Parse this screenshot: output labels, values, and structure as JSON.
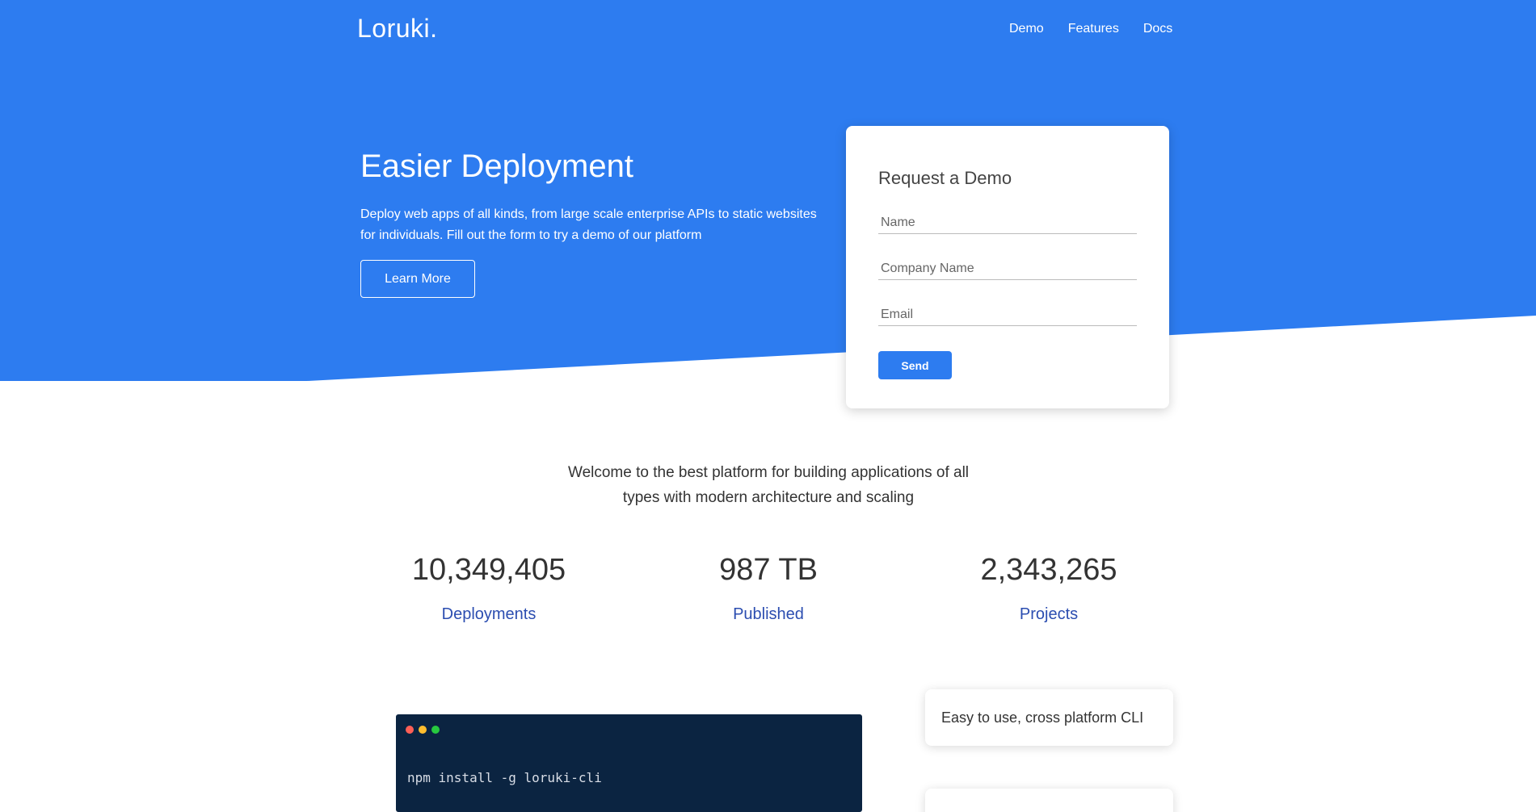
{
  "colors": {
    "brand_blue": "#2d7cf0",
    "terminal_bg": "#0b2441",
    "stat_label": "#2b4db0"
  },
  "nav": {
    "logo": "Loruki.",
    "links": [
      "Demo",
      "Features",
      "Docs"
    ]
  },
  "hero": {
    "title": "Easier Deployment",
    "text": "Deploy web apps of all kinds, from large scale enterprise APIs to static websites for individuals. Fill out the form to try a demo of our platform",
    "learn_more": "Learn More"
  },
  "demo_form": {
    "title": "Request a Demo",
    "name_placeholder": "Name",
    "company_placeholder": "Company Name",
    "email_placeholder": "Email",
    "send": "Send"
  },
  "welcome": "Welcome to the best platform for building applications of all types with modern architecture and scaling",
  "stats": [
    {
      "value": "10,349,405",
      "label": "Deployments"
    },
    {
      "value": "987 TB",
      "label": "Published"
    },
    {
      "value": "2,343,265",
      "label": "Projects"
    }
  ],
  "terminal": {
    "command": "npm install -g loruki-cli"
  },
  "features": [
    {
      "text": "Easy to use, cross platform CLI"
    },
    {
      "text": ""
    }
  ]
}
